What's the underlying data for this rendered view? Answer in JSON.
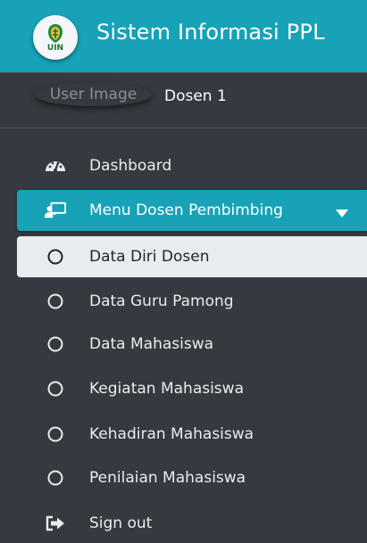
{
  "brand": {
    "title": "Sistem Informasi PPL",
    "logo_text": "UIN"
  },
  "user": {
    "image_alt": "User Image",
    "name": "Dosen 1"
  },
  "nav": {
    "dashboard": "Dashboard",
    "menu_parent": "Menu Dosen Pembimbing",
    "submenu": [
      "Data Diri Dosen",
      "Data Guru Pamong",
      "Data Mahasiswa",
      "Kegiatan Mahasiswa",
      "Kehadiran Mahasiswa",
      "Penilaian Mahasiswa"
    ],
    "signout": "Sign out"
  },
  "colors": {
    "sidebar_bg": "#343a40",
    "accent": "#17a2b8",
    "active_bg": "#e9ecef",
    "text_light": "#e9ecef"
  },
  "icons": {
    "logo": "uin-logo-icon",
    "dashboard": "tachometer-icon",
    "menu_parent": "chalkboard-teacher-icon",
    "submenu": "circle-outline-icon",
    "caret": "caret-down-icon",
    "signout": "sign-out-icon"
  }
}
